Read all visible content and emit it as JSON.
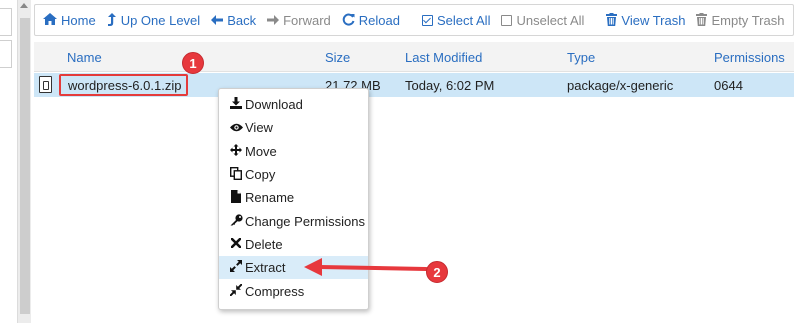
{
  "toolbar": {
    "home": "Home",
    "up_one_level": "Up One Level",
    "back": "Back",
    "forward": "Forward",
    "reload": "Reload",
    "select_all": "Select All",
    "unselect_all": "Unselect All",
    "view_trash": "View Trash",
    "empty_trash": "Empty Trash"
  },
  "table": {
    "headers": {
      "name": "Name",
      "size": "Size",
      "last_modified": "Last Modified",
      "type": "Type",
      "permissions": "Permissions"
    },
    "rows": [
      {
        "name": "wordpress-6.0.1.zip",
        "size": "21.72 MB",
        "last_modified": "Today, 6:02 PM",
        "type": "package/x-generic",
        "permissions": "0644"
      }
    ]
  },
  "context_menu": {
    "items": [
      {
        "label": "Download",
        "icon": "download-icon"
      },
      {
        "label": "View",
        "icon": "eye-icon"
      },
      {
        "label": "Move",
        "icon": "move-icon"
      },
      {
        "label": "Copy",
        "icon": "copy-icon"
      },
      {
        "label": "Rename",
        "icon": "file-icon"
      },
      {
        "label": "Change Permissions",
        "icon": "key-icon"
      },
      {
        "label": "Delete",
        "icon": "close-icon"
      },
      {
        "label": "Extract",
        "icon": "expand-icon"
      },
      {
        "label": "Compress",
        "icon": "compress-icon"
      }
    ],
    "active_item": "Extract"
  },
  "annotations": {
    "step1": "1",
    "step2": "2"
  },
  "colors": {
    "link_blue": "#2a6ec1",
    "selected_row": "#cde6f7",
    "annotation_red": "#e7383d"
  }
}
